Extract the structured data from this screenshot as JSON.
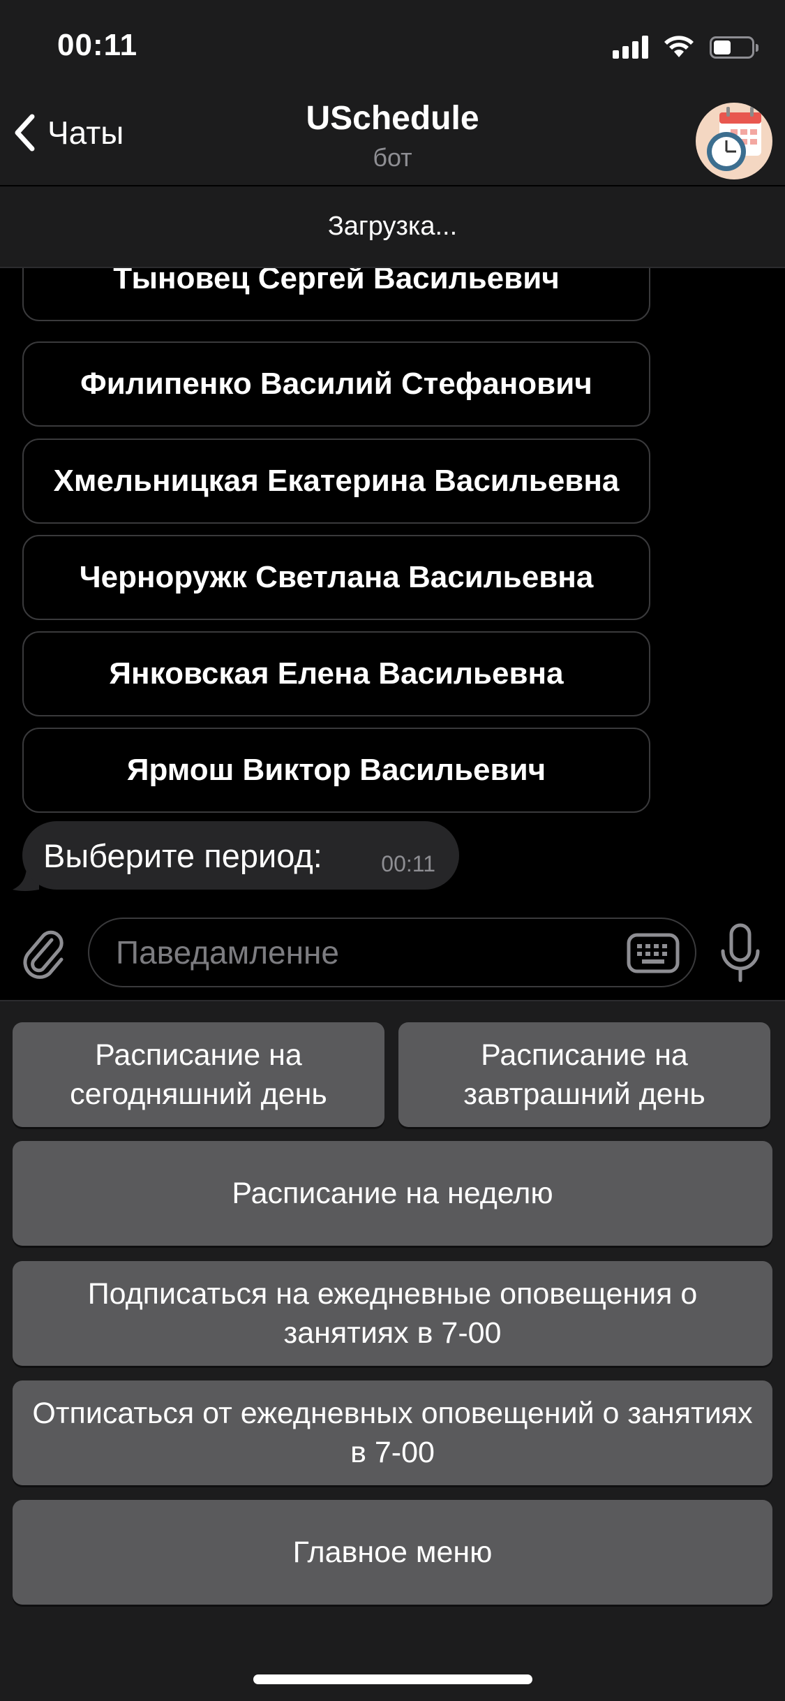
{
  "status_bar": {
    "time": "00:11"
  },
  "header": {
    "back_label": "Чаты",
    "title": "USchedule",
    "subtitle": "бот",
    "loading_text": "Загрузка..."
  },
  "chat": {
    "inline_buttons": [
      "Тыновец Сергей Васильевич",
      "Филипенко Василий Стефанович",
      "Хмельницкая Екатерина Васильевна",
      "Черноружк Светлана Васильевна",
      "Янковская Елена Васильевна",
      "Ярмош Виктор Васильевич"
    ],
    "message": {
      "text": "Выберите период:",
      "time": "00:11"
    }
  },
  "input": {
    "placeholder": "Паведамленне"
  },
  "reply_keyboard": {
    "today": "Расписание на сегодняшний день",
    "tomorrow": "Расписание на завтрашний день",
    "week": "Расписание на неделю",
    "subscribe": "Подписаться на ежедневные оповещения о занятиях в 7-00",
    "unsubscribe": "Отписаться от ежедневных оповещений о занятиях в 7-00",
    "main_menu": "Главное меню"
  },
  "colors": {
    "background": "#000000",
    "header": "#1c1c1d",
    "keyboard_button": "#5a5a5c",
    "bubble": "#262628"
  },
  "icons": [
    "signal-icon",
    "wifi-icon",
    "battery-icon",
    "back-chevron-icon",
    "calendar-clock-avatar",
    "paperclip-icon",
    "keyboard-icon",
    "microphone-icon"
  ]
}
